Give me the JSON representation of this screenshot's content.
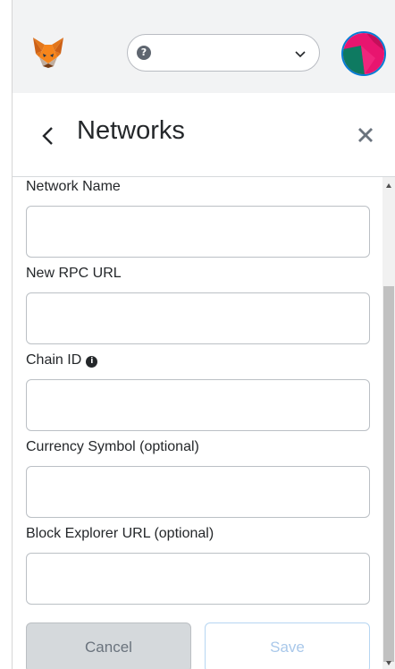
{
  "header": {
    "network_selector": {
      "value": "",
      "icon": "question-circle-icon"
    },
    "logo": "metamask-fox-logo",
    "avatar": "account-identicon"
  },
  "page": {
    "title": "Networks",
    "back_icon": "chevron-left-icon",
    "close_icon": "close-icon"
  },
  "form": {
    "fields": [
      {
        "label": "Network Name",
        "value": ""
      },
      {
        "label": "New RPC URL",
        "value": ""
      },
      {
        "label": "Chain ID",
        "value": "",
        "info_icon": "info-icon"
      },
      {
        "label": "Currency Symbol (optional)",
        "value": ""
      },
      {
        "label": "Block Explorer URL (optional)",
        "value": ""
      }
    ],
    "cancel_label": "Cancel",
    "save_label": "Save"
  },
  "colors": {
    "accent": "#037dd6",
    "header_bg": "#f2f3f4",
    "input_border": "#bbc0c5",
    "cancel_bg": "#d5d9dc",
    "save_text": "#a9c8ea"
  }
}
